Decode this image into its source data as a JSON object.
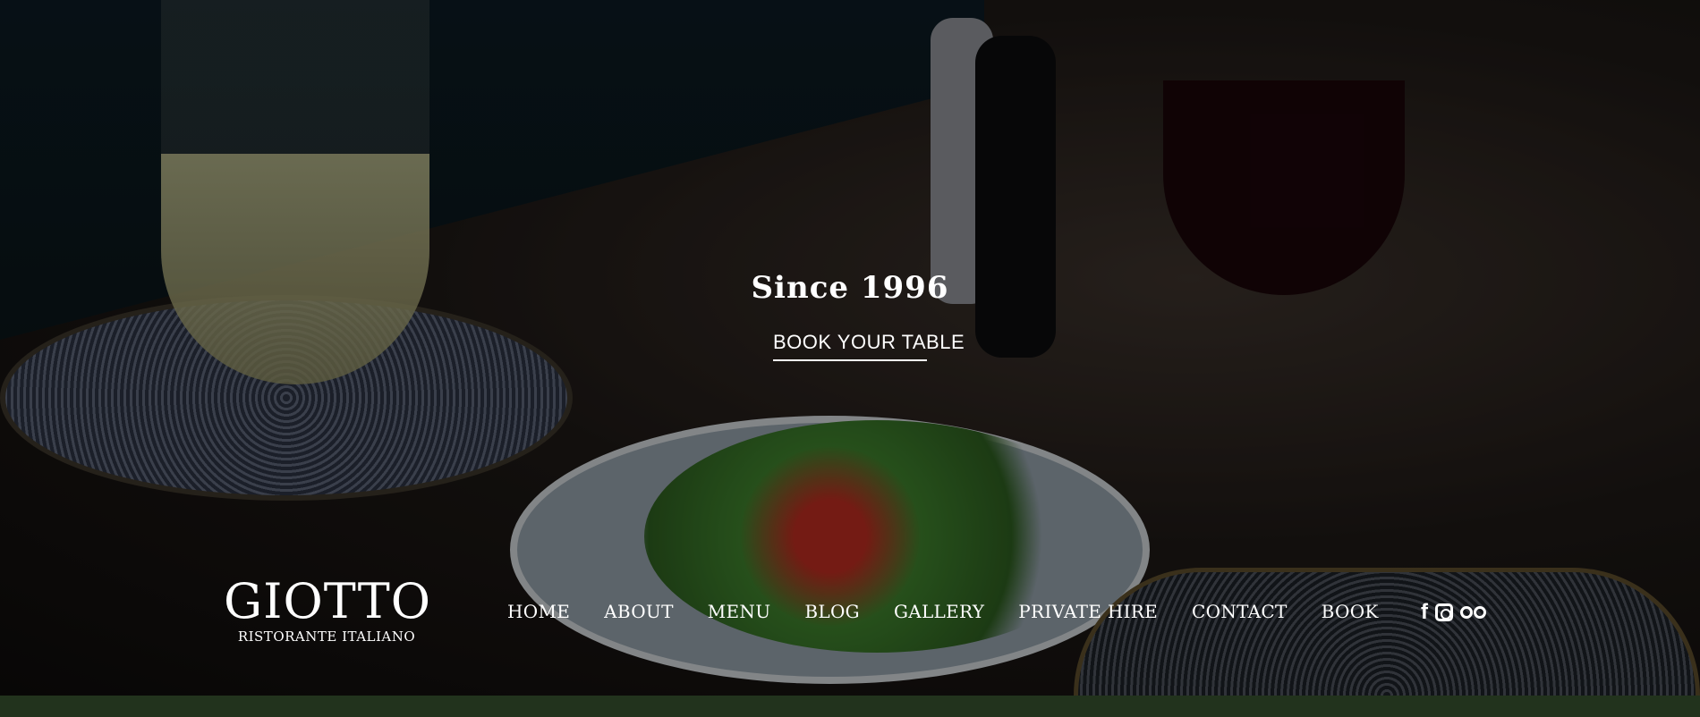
{
  "hero": {
    "tagline": "Since 1996",
    "cta_label": "BOOK YOUR TABLE"
  },
  "logo": {
    "name": "GIOTTO",
    "subtitle": "RISTORANTE ITALIANO"
  },
  "nav": {
    "items": [
      "HOME",
      "ABOUT",
      "MENU",
      "BLOG",
      "GALLERY",
      "PRIVATE HIRE",
      "CONTACT",
      "BOOK"
    ]
  },
  "social": {
    "facebook_glyph": "f",
    "icons": [
      "facebook-icon",
      "instagram-icon",
      "tripadvisor-icon"
    ]
  },
  "colors": {
    "footer_bar": "#22331d"
  }
}
